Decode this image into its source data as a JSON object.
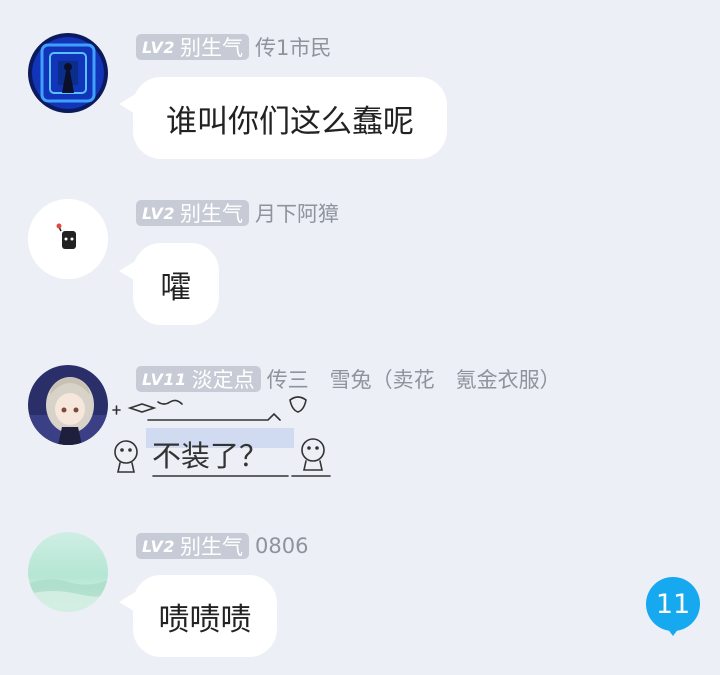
{
  "messages": [
    {
      "level": "LV2",
      "title": "别生气",
      "nickname": "传1市民",
      "text": "谁叫你们这么蠢呢"
    },
    {
      "level": "LV2",
      "title": "别生气",
      "nickname": "月下阿獐",
      "text": "嚯"
    },
    {
      "level": "LV11",
      "title": "淡定点",
      "nickname": "传三　雪兔（卖花　氪金衣服）",
      "text": "不装了？"
    },
    {
      "level": "LV2",
      "title": "别生气",
      "nickname": "0806",
      "text": "啧啧啧"
    }
  ],
  "unread_count": "11",
  "colors": {
    "background": "#eceff5",
    "badge": "#c6cbd6",
    "unread_badge": "#16a9f0",
    "bubble": "#ffffff",
    "nickname": "#8e939c"
  }
}
